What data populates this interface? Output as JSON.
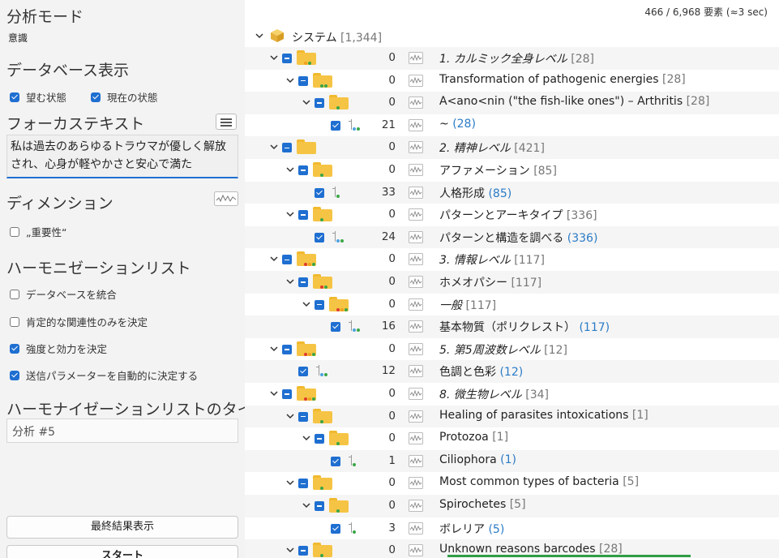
{
  "left": {
    "analysis_mode_title": "分析モード",
    "analysis_mode_value": "意識",
    "database_title": "データベース表示",
    "db_checks": [
      {
        "label": "望む状態",
        "checked": true
      },
      {
        "label": "現在の状態",
        "checked": true
      }
    ],
    "focus_title": "フォーカステキスト",
    "focus_text": "私は過去のあらゆるトラウマが優しく解放され、心身が軽やかさと安心で満た",
    "dimension_title": "ディメンション",
    "dimension_check": {
      "label": "„重要性“",
      "checked": false
    },
    "harmonization_title": "ハーモニゼーションリスト",
    "harmonization_checks": [
      {
        "label": "データベースを統合",
        "checked": false
      },
      {
        "label": "肯定的な関連性のみを決定",
        "checked": false
      },
      {
        "label": "強度と効力を決定",
        "checked": true
      },
      {
        "label": "送信パラメーターを自動的に決定する",
        "checked": true
      }
    ],
    "list_title_heading": "ハーモナイゼーションリストのタイトル",
    "list_title_value": "分析 #5",
    "final_button": "最終結果表示",
    "start_button": "スタート"
  },
  "right": {
    "status": "466 / 6,968 要素 (≈3 sec)",
    "root": {
      "name": "システム",
      "count": "[1,344]"
    },
    "colors": {
      "accent": "#1f6fd1",
      "folder": "#f6c444",
      "link_count": "#2a7bc6"
    },
    "rows": [
      {
        "type": "folder",
        "indent": 0,
        "count": "0",
        "name": "1. カルミック全身レベル",
        "bracket": "[28]",
        "italic": true,
        "dots": [
          "#f0a020",
          "#3aa648"
        ]
      },
      {
        "type": "folder",
        "indent": 1,
        "count": "0",
        "name": "Transformation of pathogenic energies",
        "bracket": "[28]",
        "italic": false,
        "dots": [
          "#3aa648",
          "#3aa648"
        ]
      },
      {
        "type": "folder",
        "indent": 2,
        "count": "0",
        "name": "A<ano<nin (\"the fish-like ones\") – Arthritis",
        "bracket": "[28]",
        "italic": false,
        "dots": [
          "#3aa648"
        ]
      },
      {
        "type": "leaf",
        "indent": 3,
        "count": "21",
        "name": "~",
        "bracket": "(28)",
        "italic": false,
        "dots": [
          "#4da3e0",
          "#3aa648"
        ]
      },
      {
        "type": "folder",
        "indent": 0,
        "count": "0",
        "name": "2. 精神レベル",
        "bracket": "[421]",
        "italic": true,
        "dots": []
      },
      {
        "type": "folder",
        "indent": 1,
        "count": "0",
        "name": "アファメーション",
        "bracket": "[85]",
        "italic": false,
        "dots": [
          "#3aa648"
        ]
      },
      {
        "type": "leaf",
        "indent": 2,
        "count": "33",
        "name": "人格形成",
        "bracket": "(85)",
        "italic": false,
        "dots": [
          "#3aa648"
        ]
      },
      {
        "type": "folder",
        "indent": 1,
        "count": "0",
        "name": "パターンとアーキタイプ",
        "bracket": "[336]",
        "italic": false,
        "dots": [
          "#3aa648"
        ]
      },
      {
        "type": "leaf",
        "indent": 2,
        "count": "24",
        "name": "パターンと構造を調べる",
        "bracket": "(336)",
        "italic": false,
        "dots": [
          "#4da3e0",
          "#3aa648"
        ]
      },
      {
        "type": "folder",
        "indent": 0,
        "count": "0",
        "name": "3. 情報レベル",
        "bracket": "[117]",
        "italic": true,
        "dots": [
          "#e03a2f",
          "#f0a020",
          "#3aa648"
        ]
      },
      {
        "type": "folder",
        "indent": 1,
        "count": "0",
        "name": "ホメオパシー",
        "bracket": "[117]",
        "italic": false,
        "dots": [
          "#e03a2f",
          "#3aa648"
        ]
      },
      {
        "type": "folder",
        "indent": 2,
        "count": "0",
        "name": "一般",
        "bracket": "[117]",
        "italic": true,
        "dots": [
          "#e03a2f",
          "#f0a020",
          "#3aa648"
        ]
      },
      {
        "type": "leaf",
        "indent": 3,
        "count": "16",
        "name": "基本物質（ポリクレスト）",
        "bracket": "(117)",
        "italic": false,
        "dots": [
          "#4da3e0",
          "#3aa648"
        ]
      },
      {
        "type": "folder",
        "indent": 0,
        "count": "0",
        "name": "5. 第5周波数レベル",
        "bracket": "[12]",
        "italic": true,
        "dots": [
          "#e03a2f",
          "#f0a020",
          "#3aa648"
        ]
      },
      {
        "type": "leaf",
        "indent": 1,
        "count": "12",
        "name": "色調と色彩",
        "bracket": "(12)",
        "italic": false,
        "dots": [
          "#4da3e0",
          "#3aa648"
        ]
      },
      {
        "type": "folder",
        "indent": 0,
        "count": "0",
        "name": "8. 微生物レベル",
        "bracket": "[34]",
        "italic": true,
        "dots": [
          "#e03a2f",
          "#f0a020",
          "#3aa648"
        ]
      },
      {
        "type": "folder",
        "indent": 1,
        "count": "0",
        "name": "Healing of parasites intoxications",
        "bracket": "[1]",
        "italic": false,
        "dots": [
          "#3aa648"
        ]
      },
      {
        "type": "folder",
        "indent": 2,
        "count": "0",
        "name": "Protozoa",
        "bracket": "[1]",
        "italic": false,
        "dots": [
          "#3aa648"
        ]
      },
      {
        "type": "leaf",
        "indent": 3,
        "count": "1",
        "name": "Ciliophora",
        "bracket": "(1)",
        "italic": false,
        "dots": [
          "#3aa648"
        ]
      },
      {
        "type": "folder",
        "indent": 1,
        "count": "0",
        "name": "Most common types of bacteria",
        "bracket": "[5]",
        "italic": false,
        "dots": [
          "#3aa648"
        ]
      },
      {
        "type": "folder",
        "indent": 2,
        "count": "0",
        "name": "Spirochetes",
        "bracket": "[5]",
        "italic": false,
        "dots": [
          "#3aa648"
        ]
      },
      {
        "type": "leaf",
        "indent": 3,
        "count": "3",
        "name": "ボレリア",
        "bracket": "(5)",
        "italic": false,
        "dots": [
          "#3aa648"
        ]
      },
      {
        "type": "folder",
        "indent": 1,
        "count": "0",
        "name": "Unknown reasons barcodes",
        "bracket": "[28]",
        "italic": false,
        "dots": [
          "#3aa648"
        ]
      }
    ]
  }
}
